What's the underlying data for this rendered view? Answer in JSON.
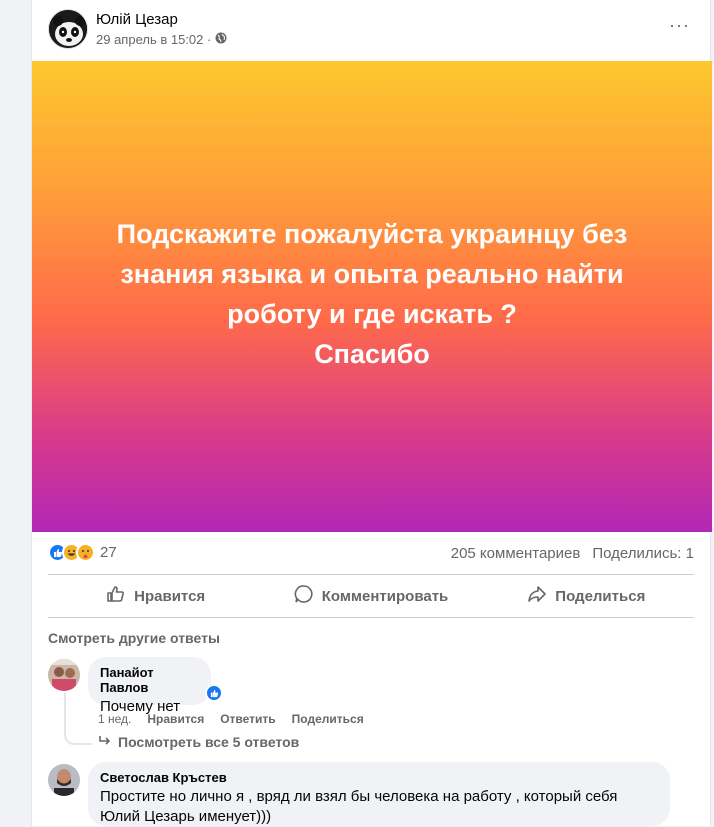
{
  "post": {
    "author": "Юлій Цезар",
    "date": "29 апрель в 15:02 ·",
    "more": "···",
    "text": "Подскажите пожалуйста украинцу без\nзнания языка и опыта реально найти\nроботу и где искать ?\nСпасибо",
    "gradient": [
      "#fdc82f",
      "#ff6a4a",
      "#b227b6"
    ]
  },
  "stats": {
    "reactions_count": "27",
    "comments": "205 комментариев",
    "shares": "Поделились: 1"
  },
  "actions": {
    "like": "Нравится",
    "comment": "Комментировать",
    "share": "Поделиться"
  },
  "see_more": "Смотреть другие ответы",
  "comments": [
    {
      "name": "Панайот Павлов",
      "text": "Почему нет",
      "time": "1 нед.",
      "like": "Нравится",
      "reply": "Ответить",
      "share": "Поделиться",
      "view_replies": "Посмотреть все 5 ответов"
    },
    {
      "name": "Светослав Кръстев",
      "text": "Простите но лично я , вряд ли взял бы человека на работу , который себя Юлий Цезарь именует)))"
    }
  ],
  "colors": {
    "accent": "#1877f2",
    "muted": "#65676b"
  }
}
